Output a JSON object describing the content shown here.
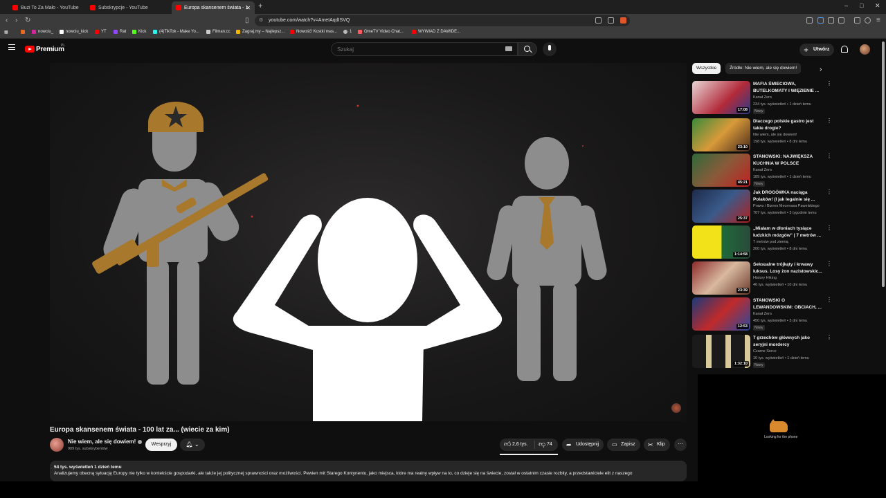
{
  "browser": {
    "tabs": [
      {
        "label": "Buzi To Za Mało - YouTube"
      },
      {
        "label": "Subskrypcje - YouTube"
      },
      {
        "label": "Europa skansenem świata - 1"
      }
    ],
    "url": "youtube.com/watch?v=AmeIAqdISVQ",
    "bookmarks": [
      {
        "label": "nowciu_"
      },
      {
        "label": "nowciu_kick"
      },
      {
        "label": "YT"
      },
      {
        "label": "Rat"
      },
      {
        "label": "Kick"
      },
      {
        "label": "(4)TikTok - Make Yo..."
      },
      {
        "label": "Filman.cc"
      },
      {
        "label": "Zagraj.my – Najlepsz..."
      },
      {
        "label": "Nowość! Kostki mas..."
      },
      {
        "label": "1"
      },
      {
        "label": "OmeTV Video Chat..."
      },
      {
        "label": "WYWIAD Z DAWIDE..."
      }
    ]
  },
  "header": {
    "brand": "Premium",
    "region": "PL",
    "search_placeholder": "Szukaj",
    "create_label": "Utwórz"
  },
  "video": {
    "title": "Europa skansenem świata - 100 lat za... (wiecie za kim)",
    "channel": "Nie wiem, ale się dowiem!",
    "subscribers": "909 tys. subskrybentów",
    "support_label": "Wesprzyj",
    "likes": "2,6 tys.",
    "dislikes": "74",
    "share_label": "Udostępnij",
    "save_label": "Zapisz",
    "clip_label": "Klip",
    "description_meta": "54 tys. wyświetleń  1 dzień temu",
    "description": "Analizujemy obecną sytuację Europy nie tylko w kontekście gospodarki, ale także jej politycznej sprawności oraz możliwości. Pewien mit Starego Kontynentu, jako miejsca, które ma realny wpływ na to, co dzieje się na świecie, został w ostatnim czasie rozbity, a przedstawiciele elit z naszego"
  },
  "chips": [
    {
      "label": "Wszystkie"
    },
    {
      "label": "Źródło: Nie wiem, ale się dowiem!"
    }
  ],
  "recommendations": [
    {
      "title": "MAFIA ŚMIECIOWA, BUTELKOMATY I WIĘZIENIE ...",
      "channel": "Kanał Zero",
      "meta": "234 tys. wyświetleń • 1 dzień temu",
      "badge": "Nowy",
      "duration": "17:08"
    },
    {
      "title": "Dlaczego polskie gastro jest takie drogie?",
      "channel": "Nie wiem, ale się dowiem!",
      "meta": "198 tys. wyświetleń • 8 dni temu",
      "badge": "",
      "duration": "23:10"
    },
    {
      "title": "STANOWSKI: NAJWIĘKSZA KUCHNIA W POLSCE",
      "channel": "Kanał Zero",
      "meta": "189 tys. wyświetleń • 1 dzień temu",
      "badge": "Nowy",
      "duration": "45:21"
    },
    {
      "title": "Jak DROGÓWKA naciąga Polaków! (I jak legalnie się ...",
      "channel": "Prawo i Biznes Mecenasa Pawelskiego",
      "meta": "707 tys. wyświetleń • 3 tygodnie temu",
      "badge": "",
      "duration": "25:37"
    },
    {
      "title": "„Miałam w dłoniach tysiące ludzkich mózgów\" | 7 metrów ...",
      "channel": "7 metrów pod ziemią",
      "meta": "200 tys. wyświetleń • 8 dni temu",
      "badge": "",
      "duration": "1:14:58"
    },
    {
      "title": "Seksualne trójkąty i krwawy luksus. Losy żon nazistowskic...",
      "channel": "History Hiking",
      "meta": "46 tys. wyświetleń • 10 dni temu",
      "badge": "",
      "duration": "23:39"
    },
    {
      "title": "STANOWSKI O LEWANDOWSKIM: OBCIACH, ...",
      "channel": "Kanał Zero",
      "meta": "450 tys. wyświetleń • 3 dni temu",
      "badge": "Nowy",
      "duration": "12:53"
    },
    {
      "title": "7 grzechów głównych jako seryjni mordercy",
      "channel": "Czarne Serce",
      "meta": "10 tys. wyświetleń • 1 dzień temu",
      "badge": "Nowy",
      "duration": "1:32:10"
    }
  ],
  "overlay": {
    "text": "Looking for the phone"
  }
}
